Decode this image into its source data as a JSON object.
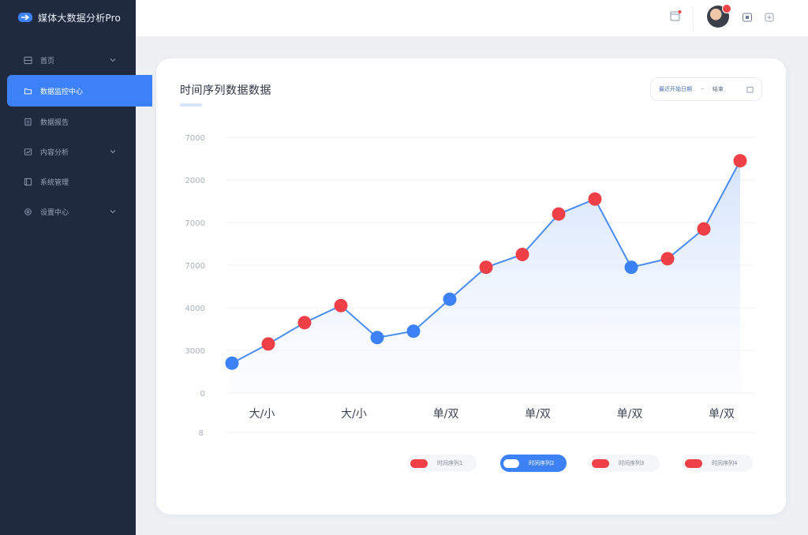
{
  "app": {
    "brand": "媒体大数据分析Pro"
  },
  "sidebar": {
    "items": [
      {
        "label": "首页",
        "icon": "home-icon",
        "has_caret": true,
        "active": false
      },
      {
        "label": "数据监控中心",
        "icon": "folder-icon",
        "has_caret": false,
        "active": true
      },
      {
        "label": "数据报告",
        "icon": "report-icon",
        "has_caret": false,
        "active": false
      },
      {
        "label": "内容分析",
        "icon": "analysis-icon",
        "has_caret": true,
        "active": false
      },
      {
        "label": "系统管理",
        "icon": "system-icon",
        "has_caret": false,
        "active": false
      },
      {
        "label": "设置中心",
        "icon": "settings-icon",
        "has_caret": true,
        "active": false
      }
    ]
  },
  "topbar": {
    "notification_icon": "calendar-icon",
    "avatar_badge": "notification-dot",
    "icons": [
      "help-icon",
      "expand-icon"
    ]
  },
  "card": {
    "title": "时间序列数据数据",
    "range": {
      "start": "最近开始日期",
      "sep": "~",
      "end": "结束",
      "icon": "calendar-icon"
    }
  },
  "chart_data": {
    "type": "line",
    "title": "时间序列数据数据",
    "y_ticks": [
      "7000",
      "2000",
      "7000",
      "7000",
      "4000",
      "3000",
      "0"
    ],
    "y_extra_tick": "8",
    "x_ticks": [
      "大/小",
      "大/小",
      "单/双",
      "单/双",
      "单/双",
      "单/双"
    ],
    "x": [
      1,
      2,
      3,
      4,
      5,
      6,
      7,
      8,
      9,
      10,
      11,
      12,
      13,
      14,
      15
    ],
    "values": [
      700,
      1150,
      1650,
      2050,
      1300,
      1450,
      2200,
      2950,
      3250,
      4200,
      4550,
      2950,
      3150,
      3850,
      5450
    ],
    "point_colors": [
      "blue",
      "red",
      "red",
      "red",
      "blue",
      "blue",
      "blue",
      "red",
      "red",
      "red",
      "red",
      "blue",
      "red",
      "red",
      "red"
    ],
    "ylim": [
      0,
      6000
    ],
    "grid": true,
    "colors": {
      "line": "#4a8cf0",
      "red": "#ef4048",
      "blue": "#3c82f6",
      "fill": "#dce8fb"
    },
    "legend": [
      {
        "label": "时间序列1",
        "active": false
      },
      {
        "label": "时间序列2",
        "active": true
      },
      {
        "label": "时间序列3",
        "active": false
      },
      {
        "label": "时间序列4",
        "active": false
      }
    ]
  }
}
